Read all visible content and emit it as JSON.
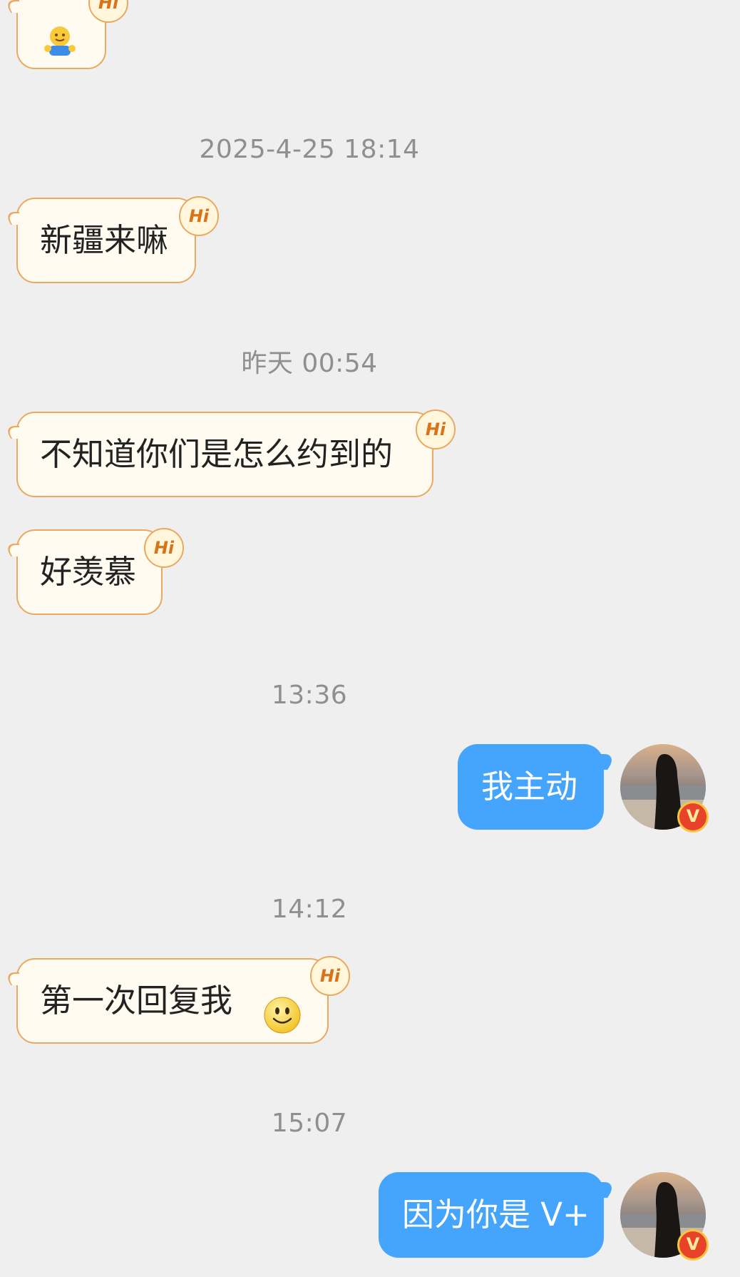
{
  "timestamps": [
    "2025-4-25 18:14",
    "昨天 00:54",
    "13:36",
    "14:12",
    "15:07"
  ],
  "messages_in": [
    {
      "text": "新疆来嘛",
      "badge": "Hi"
    },
    {
      "text": "不知道你们是怎么约到的",
      "badge": "Hi"
    },
    {
      "text": "好羡慕",
      "badge": "Hi"
    },
    {
      "text": "第一次回复我",
      "badge": "Hi"
    }
  ],
  "top_partial": {
    "badge": "Hi",
    "icon": "hug-emoji-icon"
  },
  "messages_out": [
    {
      "text": "我主动",
      "badge": "V"
    },
    {
      "text": "因为你是 V+",
      "badge": "V"
    }
  ],
  "colors": {
    "background": "#efefef",
    "incoming_bubble": "#fffbf1",
    "incoming_border": "#e9a95e",
    "outgoing_bubble": "#45a4fb",
    "timestamp_text": "#8f8f8f"
  }
}
